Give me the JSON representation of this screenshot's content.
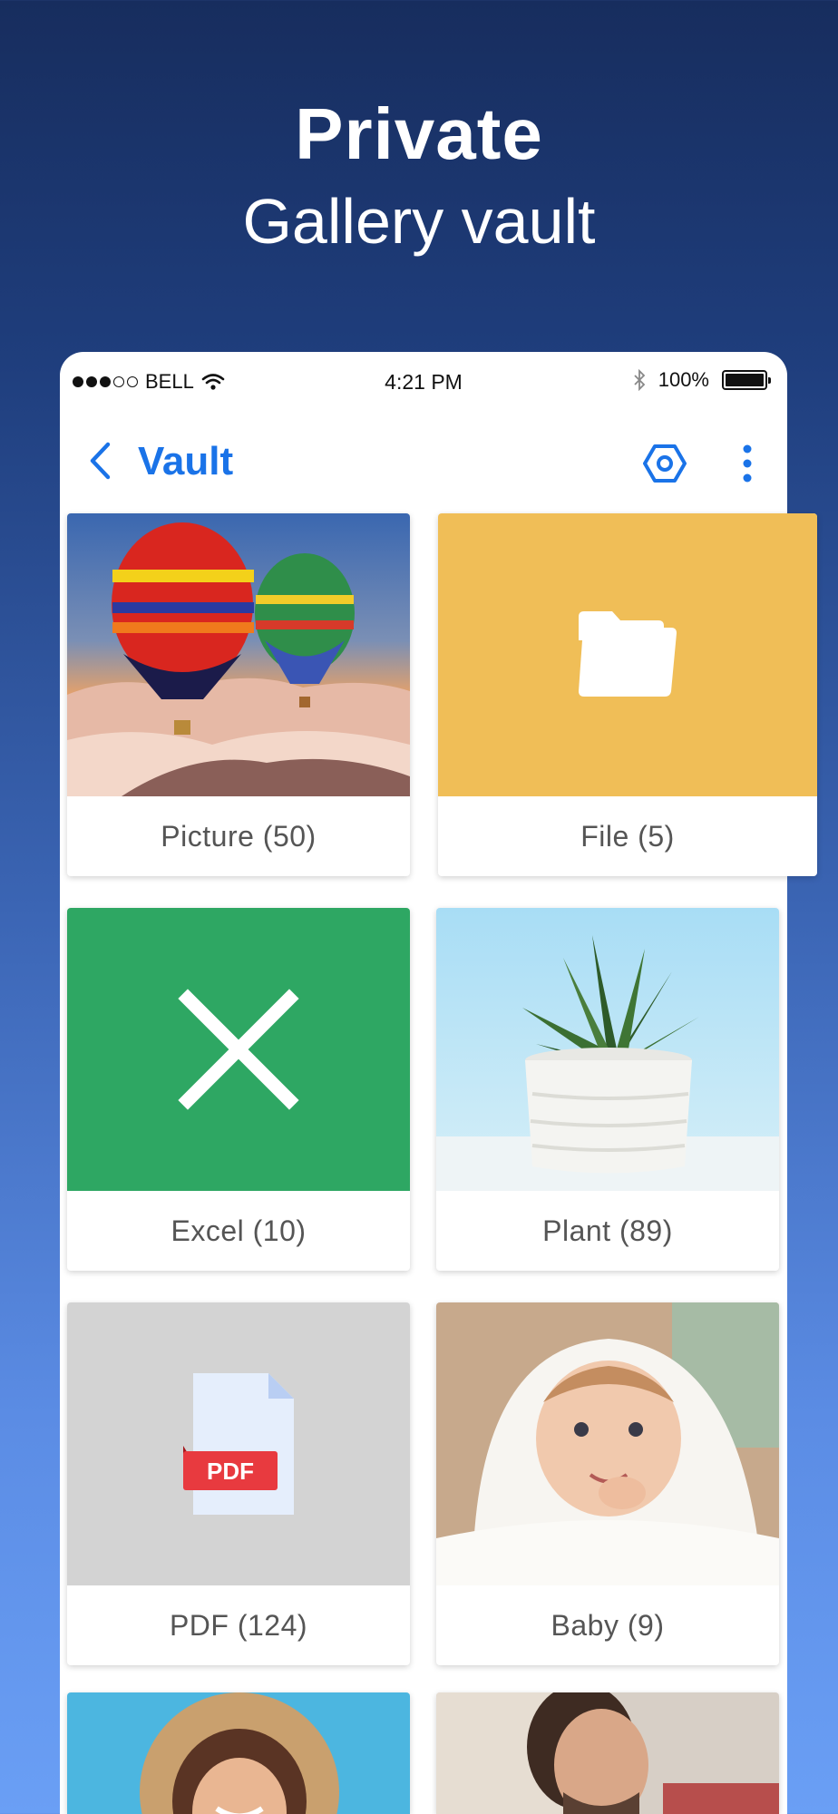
{
  "hero": {
    "title": "Private",
    "subtitle": "Gallery vault"
  },
  "status_bar": {
    "carrier": "BELL",
    "time": "4:21 PM",
    "battery": "100%",
    "battery_level": 1.0
  },
  "header": {
    "title": "Vault",
    "back_icon": "chevron-left-icon",
    "settings_icon": "hexagon-gear-icon",
    "more_icon": "more-vertical-icon"
  },
  "colors": {
    "accent": "#1a73e8",
    "file_folder": "#f0be57",
    "excel": "#2ea763",
    "pdf_red": "#e83a3f"
  },
  "folders": [
    {
      "label": "Picture (50)",
      "thumb": "hot-air-balloons-photo"
    },
    {
      "label": "File (5)",
      "thumb": "folder-icon"
    },
    {
      "label": "Excel (10)",
      "thumb": "excel-icon"
    },
    {
      "label": "Plant (89)",
      "thumb": "plant-photo"
    },
    {
      "label": "PDF (124)",
      "thumb": "pdf-file-icon",
      "badge": "PDF"
    },
    {
      "label": "Baby (9)",
      "thumb": "baby-photo"
    },
    {
      "label": "",
      "thumb": "woman-portrait-photo"
    },
    {
      "label": "",
      "thumb": "man-portrait-photo"
    }
  ]
}
